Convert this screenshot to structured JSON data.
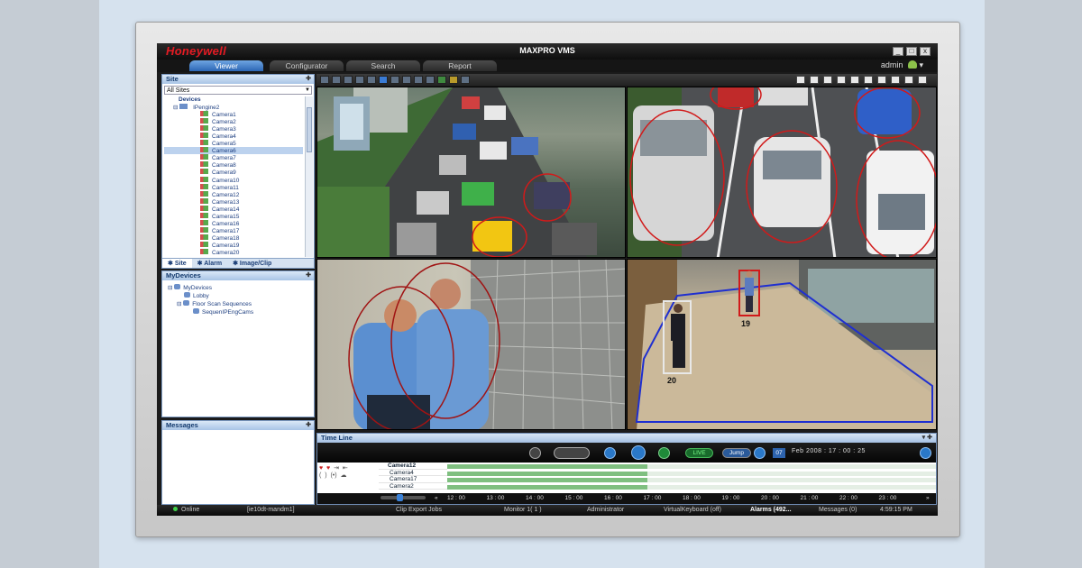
{
  "app": {
    "brand": "Honeywell",
    "title": "MAXPRO VMS",
    "tabs": [
      "Viewer",
      "Configurator",
      "Search",
      "Report"
    ],
    "active_tab": "Viewer",
    "user": "admin",
    "window_buttons": [
      "_",
      "□",
      "x"
    ]
  },
  "site_panel": {
    "title": "Site",
    "selected_site": "All Sites",
    "tree": {
      "root": "Devices",
      "engine": "IPengine2",
      "cameras": [
        "Camera1",
        "Camera2",
        "Camera3",
        "Camera4",
        "Camera5",
        "Camera6",
        "Camera7",
        "Camera8",
        "Camera9",
        "Camera10",
        "Camera11",
        "Camera12",
        "Camera13",
        "Camera14",
        "Camera15",
        "Camera16",
        "Camera17",
        "Camera18",
        "Camera19",
        "Camera20"
      ],
      "selected_camera": "Camera6"
    },
    "tabs": [
      "Site",
      "Alarm",
      "Image/Clip"
    ],
    "active_tab": "Site"
  },
  "mydevices_panel": {
    "title": "MyDevices",
    "items": [
      "MyDevices",
      "Lobby",
      "Floor Scan Sequences",
      "SequenIPEngCams"
    ]
  },
  "messages_panel": {
    "title": "Messages"
  },
  "video": {
    "feeds": [
      {
        "name": "traffic-jam"
      },
      {
        "name": "parking-lot"
      },
      {
        "name": "guards-fence"
      },
      {
        "name": "lobby-tracking",
        "track_labels": [
          "19",
          "20"
        ]
      }
    ]
  },
  "timeline": {
    "title": "Time Line",
    "live_label": "LIVE",
    "jump_label": "Jump",
    "date_day": "07",
    "date_text": "Feb      2008 :  17 :  00 :  25",
    "selected_camera": "Camera12",
    "cameras": [
      "Camera4",
      "Camera17",
      "Camera2"
    ],
    "hours": [
      "12 : 00",
      "13 : 00",
      "14 : 00",
      "15 : 00",
      "16 : 00",
      "17 : 00",
      "18 : 00",
      "19 : 00",
      "20 : 00",
      "21 : 00",
      "22 : 00",
      "23 : 00"
    ],
    "recorded_fraction": 0.41
  },
  "status_bar": {
    "online": "Online",
    "host": "[ie10dt-mandm1]",
    "clip_export": "Clip Export Jobs",
    "monitor": "Monitor 1( 1 )",
    "role": "Administrator",
    "keyboard": "VirtualKeyboard (off)",
    "alarms": "Alarms (492...",
    "messages": "Messages (0)",
    "time": "4:59:15 PM"
  },
  "colors": {
    "brand_red": "#e31b23",
    "accent_blue": "#2c66b5",
    "tracking_red": "#d11a1a",
    "zone_blue": "#1f2fd0"
  }
}
